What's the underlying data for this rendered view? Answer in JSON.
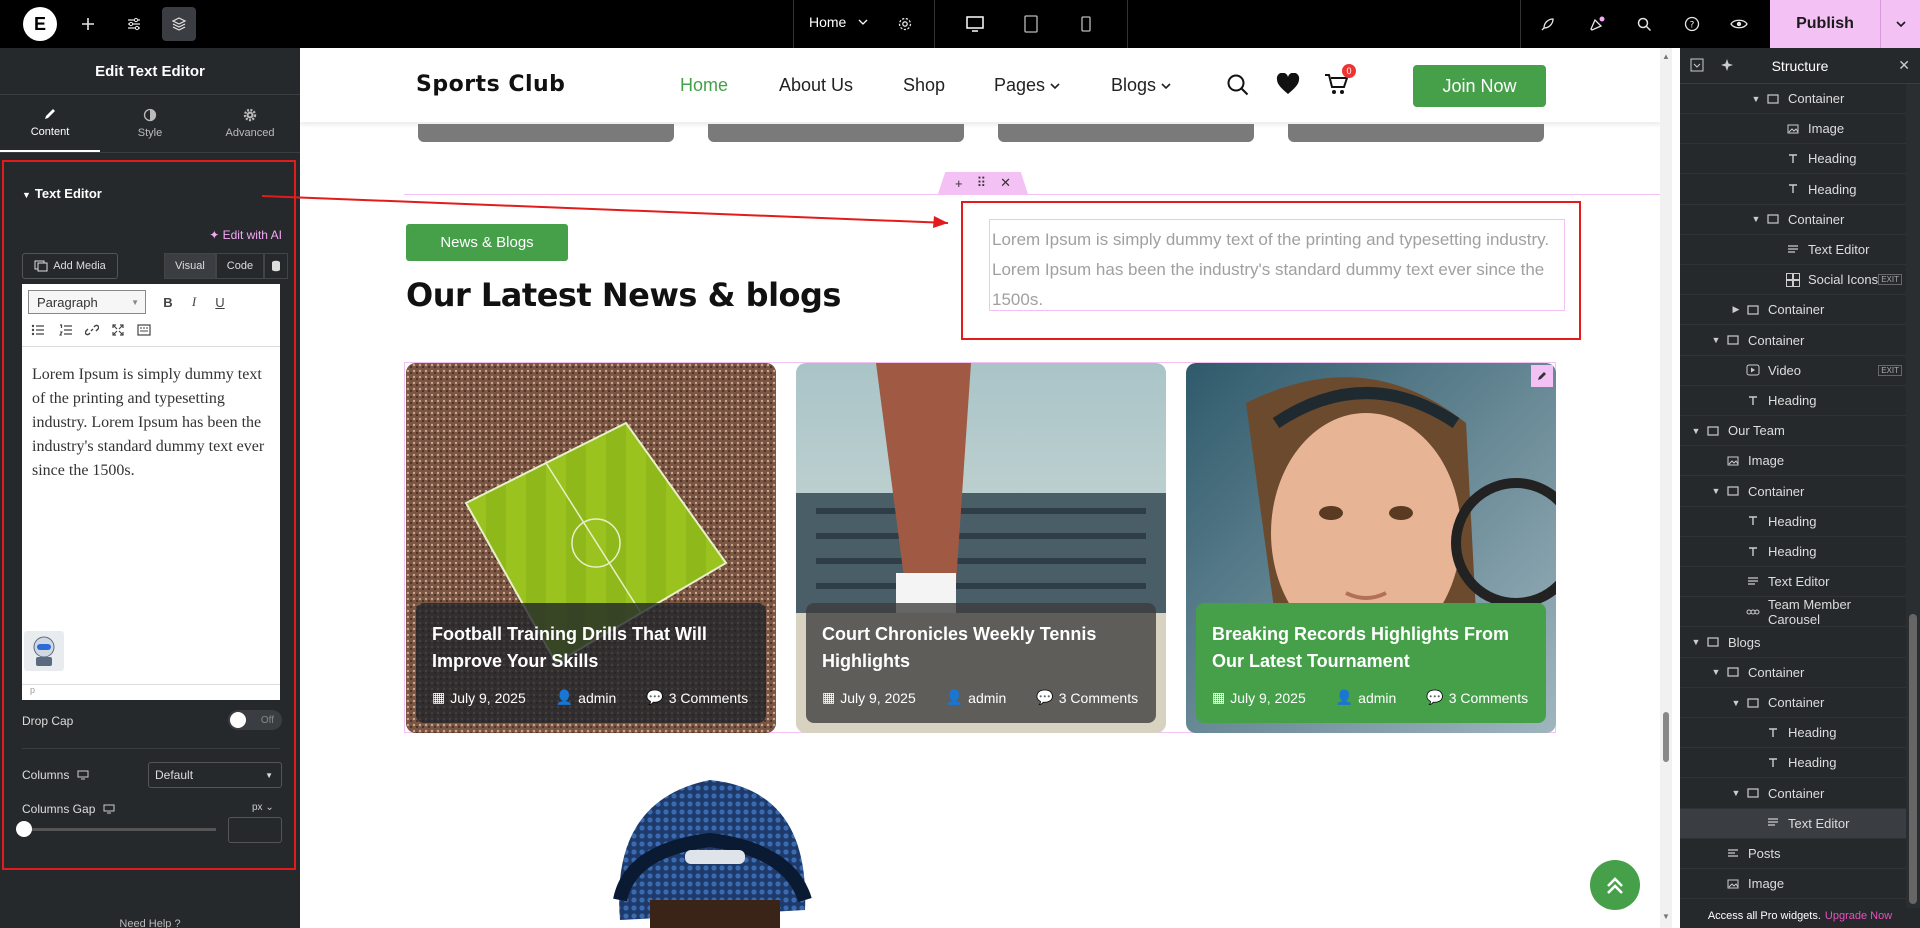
{
  "topbar": {
    "page_select": "Home",
    "publish_label": "Publish"
  },
  "left_panel": {
    "title": "Edit Text Editor",
    "tabs": [
      {
        "label": "Content"
      },
      {
        "label": "Style"
      },
      {
        "label": "Advanced"
      }
    ],
    "section_title": "Text Editor",
    "edit_ai": "Edit with AI",
    "add_media": "Add Media",
    "visual_tab": "Visual",
    "code_tab": "Code",
    "paragraph_select": "Paragraph",
    "editor_text": "Lorem Ipsum is simply dummy text of the printing and typesetting industry. Lorem Ipsum has been the industry's standard dummy text ever since the 1500s.",
    "editor_footer": "p",
    "drop_cap_label": "Drop Cap",
    "drop_cap_value": "Off",
    "columns_label": "Columns",
    "columns_value": "Default",
    "columns_gap_label": "Columns Gap",
    "columns_gap_unit": "px",
    "need_help": "Need Help"
  },
  "site": {
    "logo": "Sports Club",
    "nav": [
      {
        "label": "Home"
      },
      {
        "label": "About Us"
      },
      {
        "label": "Shop"
      },
      {
        "label": "Pages"
      },
      {
        "label": "Blogs"
      }
    ],
    "cart_count": "0",
    "join_label": "Join Now",
    "news_badge": "News & Blogs",
    "section_title": "Our Latest News & blogs",
    "section_text": "Lorem Ipsum is simply dummy text of the printing and typesetting industry. Lorem Ipsum has been the industry's standard dummy text ever since the 1500s.",
    "cards": [
      {
        "title": "Football Training Drills That Will Improve Your Skills",
        "date": "July 9, 2025",
        "author": "admin",
        "comments": "3 Comments"
      },
      {
        "title": "Court Chronicles Weekly Tennis Highlights",
        "date": "July 9, 2025",
        "author": "admin",
        "comments": "3 Comments"
      },
      {
        "title": "Breaking Records Highlights From Our Latest Tournament",
        "date": "July 9, 2025",
        "author": "admin",
        "comments": "3 Comments"
      }
    ],
    "colors": {
      "accent": "#46a04a",
      "highlight": "#f4c1f5",
      "annotation": "#e21b1b"
    }
  },
  "structure": {
    "title": "Structure",
    "rows": [
      {
        "label": "Container"
      },
      {
        "label": "Image"
      },
      {
        "label": "Heading"
      },
      {
        "label": "Heading"
      },
      {
        "label": "Container"
      },
      {
        "label": "Text Editor"
      },
      {
        "label": "Social Icons"
      },
      {
        "label": "Container"
      },
      {
        "label": "Container"
      },
      {
        "label": "Video"
      },
      {
        "label": "Heading"
      },
      {
        "label": "Our Team"
      },
      {
        "label": "Image"
      },
      {
        "label": "Container"
      },
      {
        "label": "Heading"
      },
      {
        "label": "Heading"
      },
      {
        "label": "Text Editor"
      },
      {
        "label": "Team Member Carousel"
      },
      {
        "label": "Blogs"
      },
      {
        "label": "Container"
      },
      {
        "label": "Container"
      },
      {
        "label": "Heading"
      },
      {
        "label": "Heading"
      },
      {
        "label": "Container"
      },
      {
        "label": "Text Editor"
      },
      {
        "label": "Posts"
      },
      {
        "label": "Image"
      }
    ],
    "exit_badge": "EXIT",
    "footer_text": "Access all Pro widgets.",
    "footer_link": "Upgrade Now"
  }
}
